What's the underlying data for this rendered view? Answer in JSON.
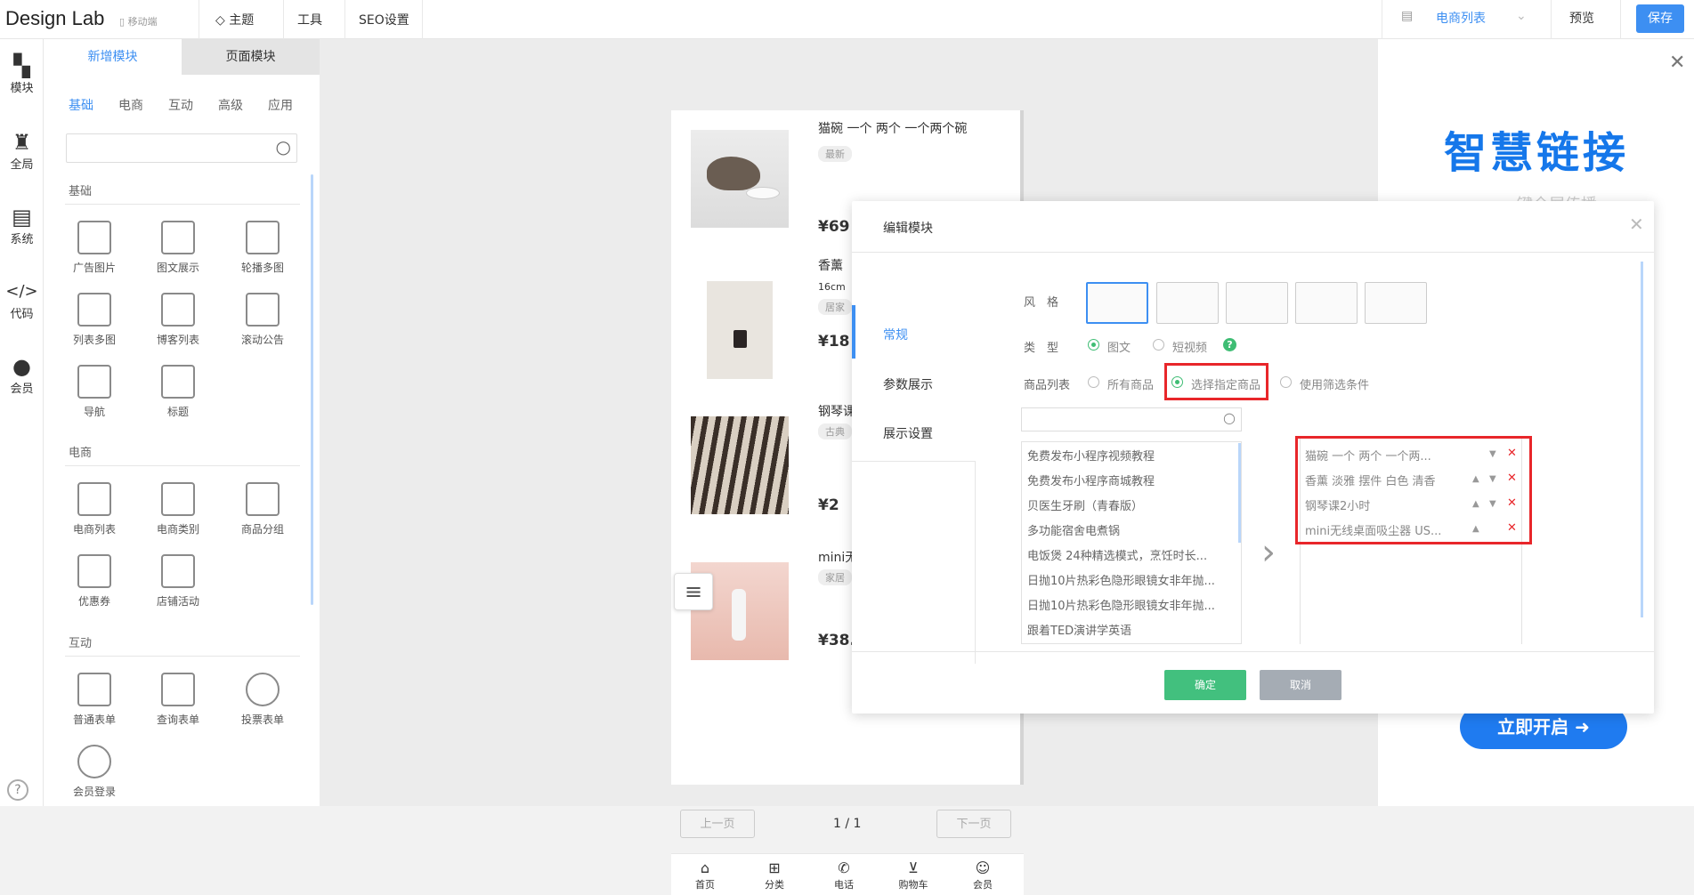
{
  "topbar": {
    "brand": "Design Lab",
    "mobile": "移动端",
    "theme": "主题",
    "tools": "工具",
    "seo": "SEO设置",
    "page_select": "电商列表",
    "preview": "预览",
    "save": "保存"
  },
  "leftnav": [
    {
      "label": "模块",
      "icon": "modules-icon"
    },
    {
      "label": "全局",
      "icon": "shirt-icon"
    },
    {
      "label": "系统",
      "icon": "document-icon"
    },
    {
      "label": "代码",
      "icon": "code-icon"
    },
    {
      "label": "会员",
      "icon": "user-icon"
    }
  ],
  "panel": {
    "tabs": [
      "新增模块",
      "页面模块"
    ],
    "subtabs": [
      "基础",
      "电商",
      "互动",
      "高级",
      "应用"
    ],
    "sections": [
      {
        "title": "基础",
        "items": [
          "广告图片",
          "图文展示",
          "轮播多图",
          "列表多图",
          "博客列表",
          "滚动公告",
          "导航",
          "标题"
        ]
      },
      {
        "title": "电商",
        "items": [
          "电商列表",
          "电商类别",
          "商品分组",
          "优惠券",
          "店铺活动"
        ]
      },
      {
        "title": "互动",
        "items": [
          "普通表单",
          "查询表单",
          "投票表单",
          "会员登录"
        ]
      }
    ]
  },
  "phone": {
    "products": [
      {
        "name": "猫碗 一个 两个 一个两个碗",
        "tag": "最新",
        "price": "¥69"
      },
      {
        "name": "香薰",
        "sub": "16cm",
        "tag": "居家",
        "price": "¥18"
      },
      {
        "name": "钢琴课",
        "tag": "古典",
        "price": "¥2"
      },
      {
        "name": "mini无",
        "tag": "家居",
        "price": "¥38."
      }
    ],
    "prev": "上一页",
    "page": "1 / 1",
    "next": "下一页",
    "bottom_nav": [
      "首页",
      "分类",
      "电话",
      "购物车",
      "会员"
    ]
  },
  "ad": {
    "title": "智慧链接",
    "subtitle": "一键全屏传播",
    "button": "立即开启"
  },
  "modal": {
    "title": "编辑模块",
    "side_tabs": [
      "常规",
      "参数展示",
      "展示设置"
    ],
    "style_label": "风　格",
    "type_label": "类　型",
    "type_options": [
      "图文",
      "短视频"
    ],
    "list_label": "商品列表",
    "list_options": [
      "所有商品",
      "选择指定商品",
      "使用筛选条件"
    ],
    "all_products": [
      "免费发布小程序视频教程",
      "免费发布小程序商城教程",
      "贝医生牙刷（青春版）",
      "多功能宿舍电煮锅",
      "电饭煲 24种精选模式，烹饪时长...",
      "日抛10片热彩色隐形眼镜女非年抛...",
      "日抛10片热彩色隐形眼镜女非年抛...",
      "跟着TED演讲学英语"
    ],
    "selected_products": [
      "猫碗 一个 两个 一个两...",
      "香薰 淡雅 摆件 白色 清香",
      "钢琴课2小时",
      "mini无线桌面吸尘器 US..."
    ],
    "ok": "确定",
    "cancel": "取消"
  },
  "colors": {
    "accent": "#3d8ff2",
    "green": "#42c07e",
    "red": "#e8262a"
  }
}
